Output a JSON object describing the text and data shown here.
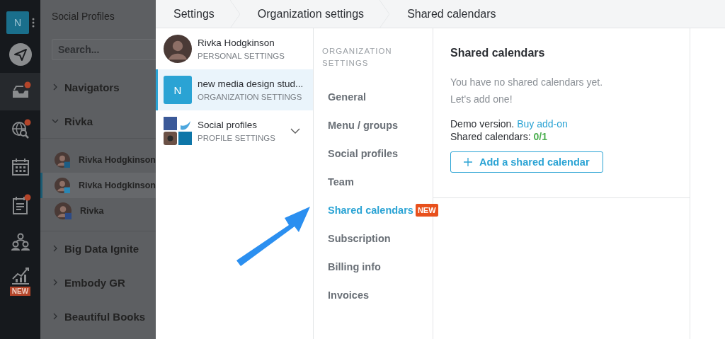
{
  "rail": {
    "account_letter": "N",
    "icons": [
      {
        "kind": "send",
        "selected": false,
        "alert": false
      },
      {
        "kind": "inbox",
        "selected": true,
        "alert": true
      },
      {
        "kind": "globe-search",
        "selected": false,
        "alert": true
      },
      {
        "kind": "calendar",
        "selected": false,
        "alert": false
      },
      {
        "kind": "clipboard",
        "selected": false,
        "alert": true
      },
      {
        "kind": "people",
        "selected": false,
        "alert": false
      },
      {
        "kind": "chart",
        "selected": false,
        "alert": false,
        "badge": "NEW"
      }
    ]
  },
  "profiles_panel": {
    "title": "Social Profiles",
    "search": {
      "placeholder": "Search..."
    },
    "groups": [
      {
        "name": "Navigators",
        "expanded": false
      },
      {
        "name": "Rivka",
        "expanded": true,
        "children": [
          {
            "name": "Rivka Hodgkinson",
            "kind": "linkedin",
            "selected": false
          },
          {
            "name": "Rivka Hodgkinson",
            "kind": "twitter",
            "selected": true
          },
          {
            "name": "Rivka",
            "kind": "facebook",
            "selected": false
          }
        ]
      },
      {
        "name": "Big Data Ignite",
        "expanded": false
      },
      {
        "name": "Embody GR",
        "expanded": false
      },
      {
        "name": "Beautiful Books",
        "expanded": false
      }
    ]
  },
  "breadcrumb": [
    "Settings",
    "Organization settings",
    "Shared calendars"
  ],
  "accounts": [
    {
      "kind": "person",
      "name": "Rivka Hodgkinson",
      "subtitle": "PERSONAL SETTINGS",
      "selected": false
    },
    {
      "kind": "organization",
      "letter": "N",
      "name": "new media design stud...",
      "subtitle": "ORGANIZATION SETTINGS",
      "selected": true
    },
    {
      "kind": "social",
      "name": "Social profiles",
      "subtitle": "PROFILE SETTINGS",
      "selected": false,
      "expanded": false
    }
  ],
  "menu": {
    "heading": "ORGANIZATION SETTINGS",
    "items": [
      {
        "label": "General",
        "selected": false
      },
      {
        "label": "Menu / groups",
        "selected": false
      },
      {
        "label": "Social profiles",
        "selected": false
      },
      {
        "label": "Team",
        "selected": false
      },
      {
        "label": "Shared calendars",
        "selected": true,
        "badge": "NEW"
      },
      {
        "label": "Subscription",
        "selected": false
      },
      {
        "label": "Billing info",
        "selected": false
      },
      {
        "label": "Invoices",
        "selected": false
      }
    ]
  },
  "content": {
    "title": "Shared calendars",
    "empty_lines": [
      "You have no shared calendars yet.",
      "Let's add one!"
    ],
    "demo_text": "Demo version.",
    "demo_link": "Buy add-on",
    "count_label": "Shared calendars:",
    "count": "0/1",
    "add_button": "Add a shared calendar"
  }
}
